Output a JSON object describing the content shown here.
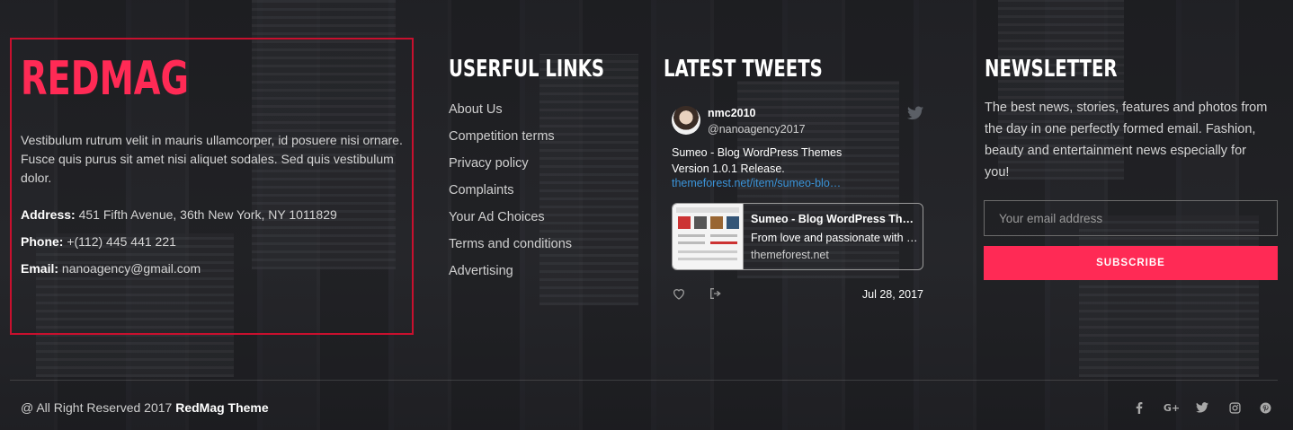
{
  "brand": {
    "logo": "REDMAG",
    "description": "Vestibulum rutrum velit in mauris ullamcorper, id posuere nisi ornare. Fusce quis purus sit amet nisi aliquet sodales. Sed quis vestibulum dolor.",
    "address_label": "Address:",
    "address_value": " 451 Fifth Avenue, 36th New York, NY 1011829",
    "phone_label": "Phone:",
    "phone_value": " +(112) 445 441 221",
    "email_label": "Email:",
    "email_value": " nanoagency@gmail.com"
  },
  "useful_links": {
    "title": "USERFUL LINKS",
    "items": [
      "About Us",
      "Competition terms",
      "Privacy policy",
      "Complaints",
      "Your Ad Choices",
      "Terms and conditions",
      "Advertising"
    ]
  },
  "tweets": {
    "title": "LATEST TWEETS",
    "user": "nmc2010",
    "handle": "@nanoagency2017",
    "text": "Sumeo - Blog WordPress Themes\n Version 1.0.1 Release.",
    "link": "themeforest.net/item/sumeo-blo…",
    "preview_title": "Sumeo - Blog WordPress The…",
    "preview_desc": "From love and passionate with …",
    "preview_domain": "themeforest.net",
    "date": "Jul 28, 2017"
  },
  "newsletter": {
    "title": "NEWSLETTER",
    "text": "The best news, stories, features and photos from the day in one perfectly formed email. Fashion, beauty and entertainment news especially for you!",
    "placeholder": "Your email address",
    "button": "SUBSCRIBE"
  },
  "footer": {
    "copyright": "@ All Right Reserved 2017 ",
    "theme": "RedMag Theme",
    "social_icons": [
      "facebook-icon",
      "google-plus-icon",
      "twitter-icon",
      "instagram-icon",
      "pinterest-icon"
    ]
  },
  "colors": {
    "accent": "#ff2a55",
    "highlight_border": "#c8102e",
    "link": "#3b94d9"
  }
}
